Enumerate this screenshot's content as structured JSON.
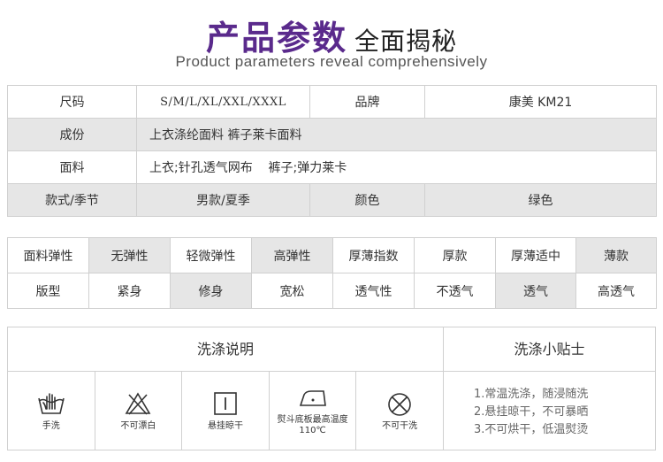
{
  "header": {
    "title_main": "产品参数",
    "title_sub": "全面揭秘",
    "subtitle": "Product parameters reveal comprehensively"
  },
  "params": {
    "size_label": "尺码",
    "size_value": "S/M/L/XL/XXL/XXXL",
    "brand_label": "品牌",
    "brand_value": "康美 KM21",
    "composition_label": "成份",
    "composition_value": "上衣涤纶面料  裤子莱卡面料",
    "fabric_label": "面料",
    "fabric_value": "上衣;针孔透气网布    裤子;弹力莱卡",
    "style_label": "款式/季节",
    "style_value": "男款/夏季",
    "color_label": "颜色",
    "color_value": "绿色"
  },
  "properties": {
    "elasticity": [
      "面料弹性",
      "无弹性",
      "轻微弹性",
      "高弹性",
      "厚薄指数",
      "厚款",
      "厚薄适中",
      "薄款"
    ],
    "fit": [
      "版型",
      "紧身",
      "修身",
      "宽松",
      "透气性",
      "不透气",
      "透气",
      "高透气"
    ],
    "elasticity_highlight": [
      false,
      true,
      false,
      true,
      false,
      false,
      false,
      true
    ],
    "fit_highlight": [
      false,
      false,
      true,
      false,
      false,
      false,
      true,
      false
    ]
  },
  "wash": {
    "title": "洗涤说明",
    "tips_title": "洗涤小贴士",
    "icons": [
      {
        "icon": "hand-wash-icon",
        "label": "手洗"
      },
      {
        "icon": "no-bleach-icon",
        "label": "不可漂白"
      },
      {
        "icon": "hang-dry-icon",
        "label": "悬挂晾干"
      },
      {
        "icon": "iron-icon",
        "label": "熨斗底板最高温度110℃"
      },
      {
        "icon": "no-dry-clean-icon",
        "label": "不可干洗"
      }
    ],
    "tips": [
      "1.常温洗涤，随浸随洗",
      "2.悬挂晾干，不可暴晒",
      "3.不可烘干，低温熨烫"
    ]
  },
  "colors": {
    "title": "#5a2a8c",
    "highlight": "#e6e6e6"
  }
}
